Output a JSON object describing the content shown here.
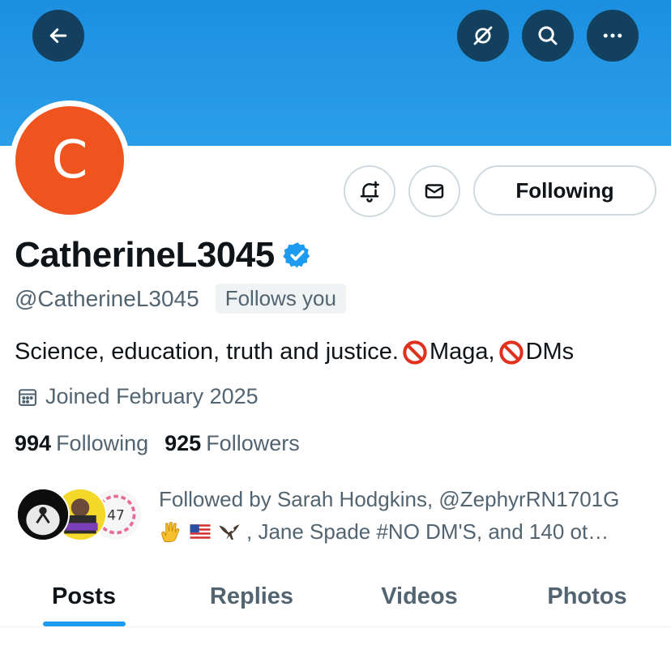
{
  "header": {
    "back_icon": "arrow-left-icon",
    "grok_icon": "grok-icon",
    "search_icon": "search-icon",
    "more_icon": "more-horizontal-icon",
    "banner_color": "#1d8fe0"
  },
  "profile": {
    "avatar_initial": "C",
    "avatar_color": "#f0541e",
    "display_name": "CatherineL3045",
    "verified": true,
    "handle": "@CatherineL3045",
    "follows_you_label": "Follows you",
    "bio_parts": [
      "Science, education, truth and justice. ",
      "Maga,",
      "DMs"
    ],
    "joined": "Joined February 2025",
    "following_count": "994",
    "following_label": "Following",
    "followers_count": "925",
    "followers_label": "Followers"
  },
  "actions": {
    "notify_icon": "bell-plus-icon",
    "message_icon": "envelope-icon",
    "following_button": "Following"
  },
  "followed_by": {
    "line1": "Followed by Sarah Hodgkins, @ZephyrRN1701G",
    "line2": ", Jane Spade #NO DM'S, and 140 ot…"
  },
  "tabs": [
    {
      "label": "Posts",
      "active": true
    },
    {
      "label": "Replies",
      "active": false
    },
    {
      "label": "Videos",
      "active": false
    },
    {
      "label": "Photos",
      "active": false
    }
  ],
  "colors": {
    "accent": "#1d9bf0",
    "text_primary": "#0f1419",
    "text_secondary": "#536471"
  }
}
